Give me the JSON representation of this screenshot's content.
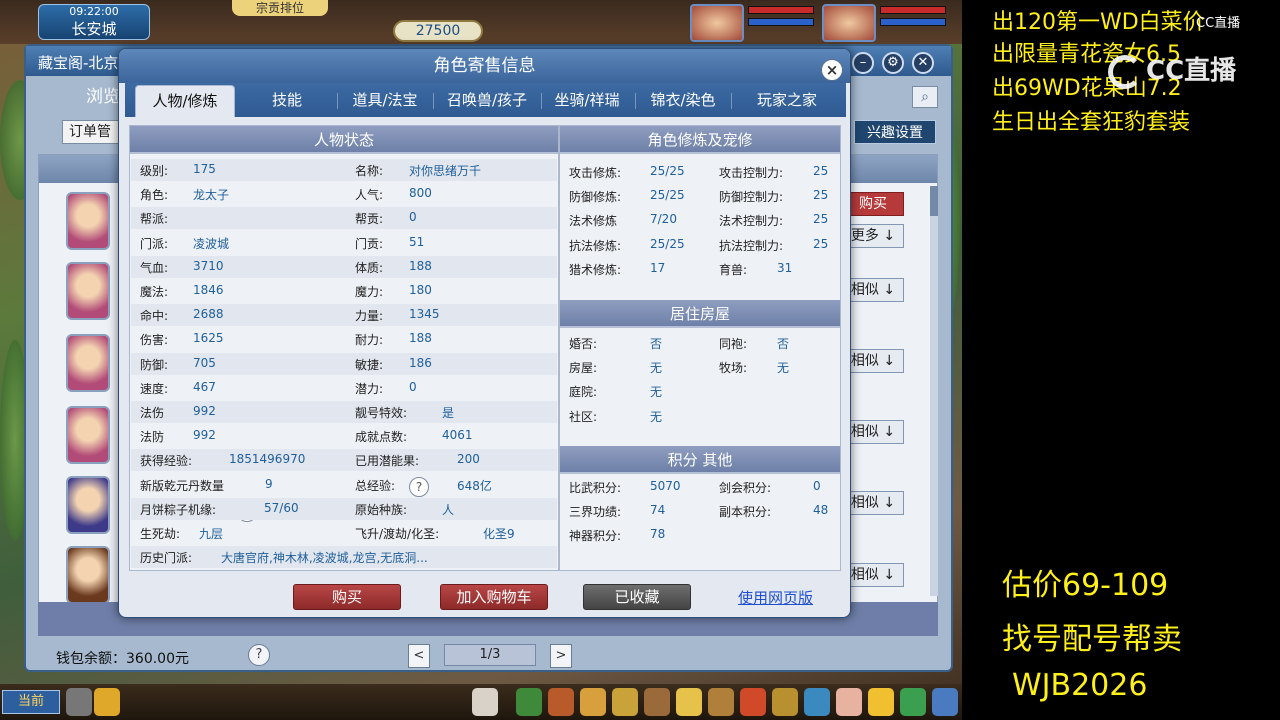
{
  "game": {
    "time": "09:22:00",
    "city": "长安城",
    "rank_label": "宗贡排位",
    "money": "27500",
    "bottom_current": "当前"
  },
  "pavilion": {
    "title": "藏宝阁-北京",
    "browse": "浏览",
    "order": "订单管",
    "interest": "兴趣设置",
    "row_buttons": [
      "购买",
      "更多",
      "相似",
      "相似",
      "相似",
      "相似",
      "相似"
    ],
    "wallet": "钱包余额：360.00元",
    "page": "1/3",
    "prev": "<",
    "next": ">",
    "help": "?"
  },
  "modal": {
    "title": "角色寄售信息",
    "close": "×",
    "tabs": [
      "人物/修炼",
      "技能",
      "道具/法宝",
      "召唤兽/孩子",
      "坐骑/祥瑞",
      "锦衣/染色",
      "玩家之家"
    ],
    "status_header": "人物状态",
    "status_left": [
      {
        "label": "级别:",
        "value": "175"
      },
      {
        "label": "角色:",
        "value": "龙太子"
      },
      {
        "label": "帮派:",
        "value": ""
      },
      {
        "label": "门派:",
        "value": "凌波城"
      },
      {
        "label": "气血:",
        "value": "3710"
      },
      {
        "label": "魔法:",
        "value": "1846"
      },
      {
        "label": "命中:",
        "value": "2688"
      },
      {
        "label": "伤害:",
        "value": "1625"
      },
      {
        "label": "防御:",
        "value": "705"
      },
      {
        "label": "速度:",
        "value": "467"
      },
      {
        "label": "法伤",
        "value": "992"
      },
      {
        "label": "法防",
        "value": "992"
      },
      {
        "label": "获得经验:",
        "value": "1851496970"
      },
      {
        "label": "新版乾元丹数量",
        "value": "9"
      },
      {
        "label": "月饼粽子机缘:",
        "value": "57/60"
      },
      {
        "label": "生死劫:",
        "value": "九层"
      },
      {
        "label": "历史门派:",
        "value": "大唐官府,神木林,凌波城,龙宫,无底洞..."
      }
    ],
    "status_right": [
      {
        "label": "名称:",
        "value": "对你思绪万千"
      },
      {
        "label": "人气:",
        "value": "800"
      },
      {
        "label": "帮贡:",
        "value": "0"
      },
      {
        "label": "门贡:",
        "value": "51"
      },
      {
        "label": "体质:",
        "value": "188"
      },
      {
        "label": "魔力:",
        "value": "180"
      },
      {
        "label": "力量:",
        "value": "1345"
      },
      {
        "label": "耐力:",
        "value": "188"
      },
      {
        "label": "敏捷:",
        "value": "186"
      },
      {
        "label": "潜力:",
        "value": "0"
      },
      {
        "label": "靓号特效:",
        "value": "是"
      },
      {
        "label": "成就点数:",
        "value": "4061"
      },
      {
        "label": "已用潜能果:",
        "value": "200"
      },
      {
        "label": "总经验:",
        "value": "648亿"
      },
      {
        "label": "原始种族:",
        "value": "人"
      },
      {
        "label": "飞升/渡劫/化圣:",
        "value": "化圣9"
      }
    ],
    "cultivation_header": "角色修炼及宠修",
    "cultivation": [
      {
        "l1": "攻击修炼:",
        "v1": "25/25",
        "l2": "攻击控制力:",
        "v2": "25"
      },
      {
        "l1": "防御修炼:",
        "v1": "25/25",
        "l2": "防御控制力:",
        "v2": "25"
      },
      {
        "l1": "法术修炼",
        "v1": "7/20",
        "l2": "法术控制力:",
        "v2": "25"
      },
      {
        "l1": "抗法修炼:",
        "v1": "25/25",
        "l2": "抗法控制力:",
        "v2": "25"
      },
      {
        "l1": "猎术修炼:",
        "v1": "17",
        "l2": "育兽:",
        "v2": "31"
      }
    ],
    "house_header": "居住房屋",
    "house": [
      {
        "l1": "婚否:",
        "v1": "否",
        "l2": "同袍:",
        "v2": "否"
      },
      {
        "l1": "房屋:",
        "v1": "无",
        "l2": "牧场:",
        "v2": "无"
      },
      {
        "l1": "庭院:",
        "v1": "无"
      },
      {
        "l1": "社区:",
        "v1": "无"
      }
    ],
    "points_header": "积分 其他",
    "points": [
      {
        "l1": "比武积分:",
        "v1": "5070",
        "l2": "剑会积分:",
        "v2": "0"
      },
      {
        "l1": "三界功绩:",
        "v1": "74",
        "l2": "副本积分:",
        "v2": "48"
      },
      {
        "l1": "神器积分:",
        "v1": "78"
      }
    ],
    "buttons": {
      "buy": "购买",
      "cart": "加入购物车",
      "fav": "已收藏",
      "web": "使用网页版"
    }
  },
  "overlay": {
    "lines": [
      "出120第一WD白菜价",
      "出限量青花瓷女6.5",
      "出69WD花果山7.2",
      "生日出全套狂豹套装"
    ],
    "price": "估价69-109",
    "service": "找号配号帮卖",
    "contact": "WJB2026",
    "logo": "CC直播",
    "logo_small": "CC直播"
  }
}
